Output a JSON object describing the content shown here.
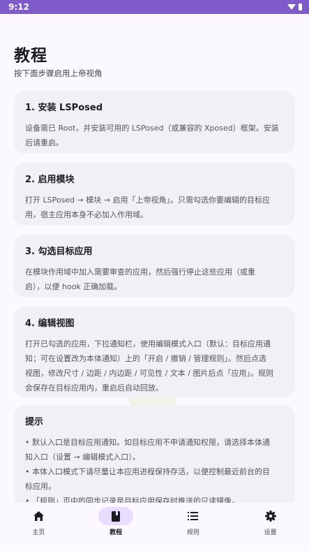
{
  "status_bar": {
    "time": "9:12"
  },
  "page": {
    "title": "教程",
    "subtitle": "按下面步骤启用上帝视角"
  },
  "cards": [
    {
      "title": "1. 安装 LSPosed",
      "lines": [
        "设备需已 Root，并安装可用的 LSPosed（或兼容的 Xposed）框架。安装",
        "后请重启。"
      ]
    },
    {
      "title": "2. 启用模块",
      "lines": [
        "打开 LSPosed → 模块 → 启用「上帝视角」。只需勾选你要编辑的目标应",
        "用，宿主应用本身不必加入作用域。"
      ]
    },
    {
      "title": "3. 勾选目标应用",
      "lines": [
        "在模块作用域中加入需要审查的应用，然后强行停止这些应用（或重",
        "启），以便 hook 正确加载。"
      ]
    },
    {
      "title": "4. 编辑视图",
      "lines": [
        "打开已勾选的应用，下拉通知栏，使用编辑模式入口（默认：目标应用通",
        "知；可在设置改为本体通知）上的「开启 / 撤销 / 管理规则」。然后点选",
        "视图，修改尺寸 / 边距 / 内边距 / 可见性 / 文本 / 图片后点「应用」。规则",
        "会保存在目标应用内，重启后自动回放。"
      ]
    },
    {
      "title": "提示",
      "lines": [
        "• 默认入口是目标应用通知。如目标应用不申请通知权限，请选择本体通",
        "知入口（设置 → 编辑模式入口）。",
        "• 本体入口模式下请尽量让本应用进程保持存活，以便控制最近前台的目",
        "标应用。",
        "• 「规则」页中的同步记录是目标应用保存时推送的只读镜像。"
      ]
    }
  ],
  "bottom_nav": [
    {
      "label": "主页",
      "icon": "home-icon",
      "active": false
    },
    {
      "label": "教程",
      "icon": "book-icon",
      "active": true
    },
    {
      "label": "规则",
      "icon": "list-icon",
      "active": false
    },
    {
      "label": "设置",
      "icon": "gear-icon",
      "active": false
    }
  ],
  "colors": {
    "status_bar": "#7f5bc9",
    "background": "#fbf8ff",
    "card": "#f2eff6",
    "active_pill": "#e9ddff"
  }
}
